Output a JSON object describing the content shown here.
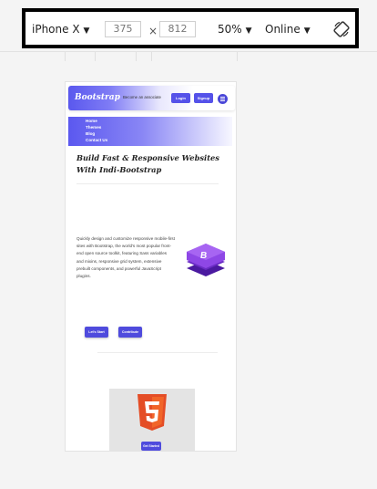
{
  "toolbar": {
    "device": "iPhone X",
    "width": "375",
    "height": "812",
    "times_sign": "×",
    "zoom": "50%",
    "network": "Online",
    "rotate_icon": "rotate-icon"
  },
  "site": {
    "brand": "Bootstrap",
    "nav_text": "Become an associate",
    "login_label": "Login",
    "signup_label": "Signup",
    "accent": "#5552e9",
    "menu": [
      "Home",
      "Themes",
      "Blog",
      "Contact Us"
    ],
    "headline": "Build Fast & Responsive Websites With Indi-Bootstrap",
    "description": "Quickly design and customize responsive mobile-first sites with Bootstrap, the world's most popular front-end open source toolkit, featuring Sass variables and mixins, responsive grid system, extensive prebuilt components, and powerful JavaScript plugins.",
    "cta_primary": "Let's Start",
    "cta_secondary": "Contribute",
    "card_button": "Get Started",
    "logo_icon": "bootstrap-logo-icon",
    "card_icon": "html5-icon"
  }
}
